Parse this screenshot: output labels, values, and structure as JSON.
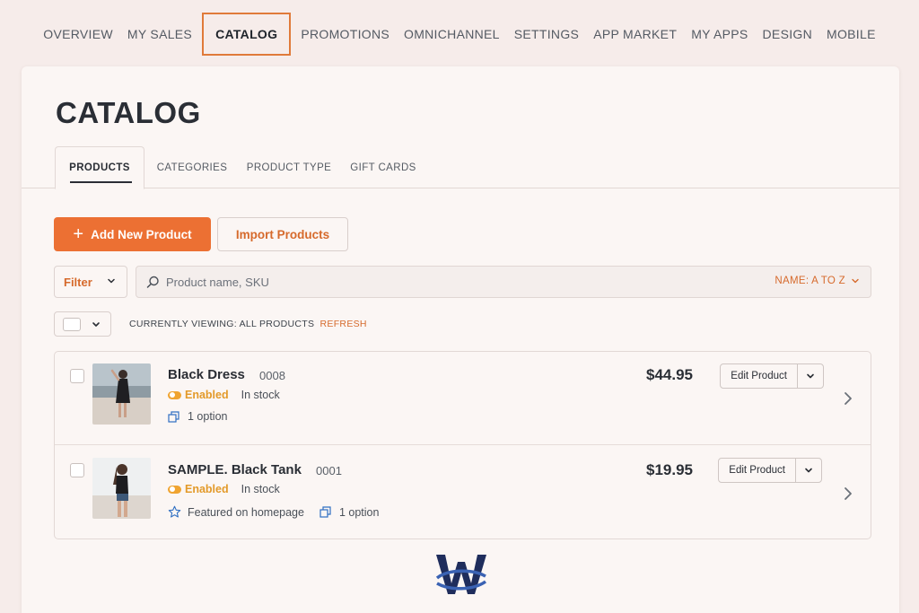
{
  "topnav": {
    "items": [
      {
        "label": "OVERVIEW",
        "active": false
      },
      {
        "label": "MY SALES",
        "active": false
      },
      {
        "label": "CATALOG",
        "active": true
      },
      {
        "label": "PROMOTIONS",
        "active": false
      },
      {
        "label": "OMNICHANNEL",
        "active": false
      },
      {
        "label": "SETTINGS",
        "active": false
      },
      {
        "label": "APP MARKET",
        "active": false
      },
      {
        "label": "MY APPS",
        "active": false
      },
      {
        "label": "DESIGN",
        "active": false
      },
      {
        "label": "MOBILE",
        "active": false
      }
    ]
  },
  "page": {
    "title": "CATALOG"
  },
  "tabs": [
    {
      "label": "PRODUCTS",
      "active": true
    },
    {
      "label": "CATEGORIES",
      "active": false
    },
    {
      "label": "PRODUCT TYPE",
      "active": false
    },
    {
      "label": "GIFT CARDS",
      "active": false
    }
  ],
  "actions": {
    "add_label": "Add New Product",
    "import_label": "Import Products"
  },
  "toolbar": {
    "filter_label": "Filter",
    "search_placeholder": "Product name, SKU",
    "search_value": "",
    "sort_label": "NAME: A TO Z"
  },
  "viewing": {
    "prefix": "CURRENTLY VIEWING: ALL PRODUCTS",
    "refresh_label": "REFRESH"
  },
  "products": [
    {
      "name": "Black Dress",
      "sku": "0008",
      "status": "Enabled",
      "stock": "In stock",
      "featured": "",
      "options": "1 option",
      "price": "$44.95",
      "edit_label": "Edit Product"
    },
    {
      "name": "SAMPLE. Black Tank",
      "sku": "0001",
      "status": "Enabled",
      "stock": "In stock",
      "featured": "Featured on homepage",
      "options": "1 option",
      "price": "$19.95",
      "edit_label": "Edit Product"
    }
  ],
  "colors": {
    "accent": "#ec7033",
    "accent_text": "#d66a2c",
    "enabled": "#e39a2a",
    "background": "#f6ecea",
    "card": "#fbf6f4"
  },
  "icons": {
    "add": "plus-icon",
    "filter": "chevron-down-icon",
    "search": "search-icon",
    "sort": "chevron-down-icon",
    "status": "toggle-on-icon",
    "options": "copy-icon",
    "featured": "star-icon",
    "row_open": "chevron-right-icon",
    "logo": "logo-icon"
  }
}
